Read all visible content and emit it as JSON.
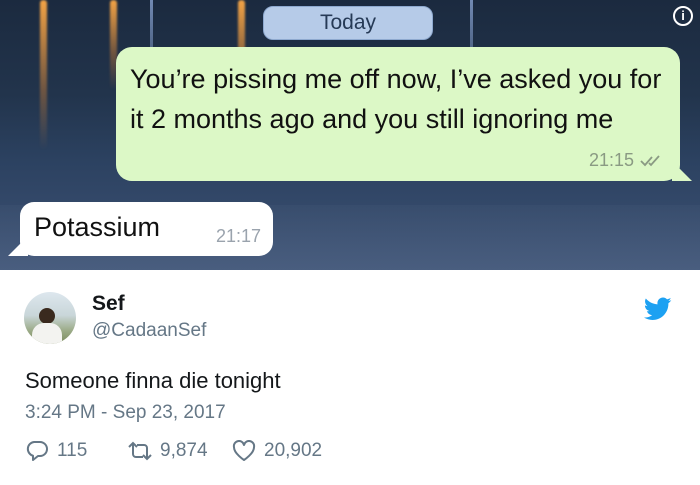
{
  "chat": {
    "date_label": "Today",
    "outgoing": {
      "text": "You’re pissing me off now, I’ve asked you for it 2 months ago and you still ignoring me",
      "time": "21:15"
    },
    "incoming": {
      "text": "Potassium",
      "time": "21:17"
    },
    "info_icon": "info-icon",
    "read_receipt_icon": "double-check-icon",
    "bubble_out_color": "#dcf8c6"
  },
  "tweet": {
    "name": "Sef",
    "handle": "@CadaanSef",
    "text": "Someone finna die tonight",
    "timestamp": "3:24 PM - Sep 23, 2017",
    "replies": "115",
    "retweets": "9,874",
    "likes": "20,902",
    "brand_color": "#1da1f2"
  }
}
